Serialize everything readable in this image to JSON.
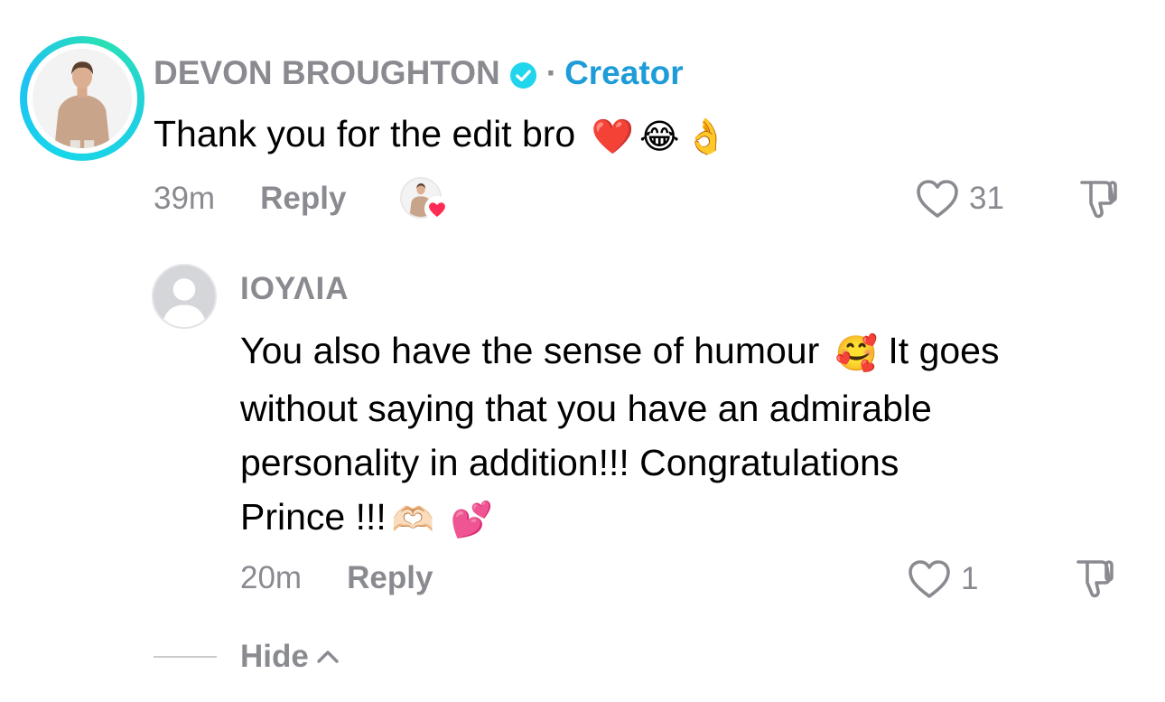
{
  "comment": {
    "username": "DEVON BROUGHTON",
    "separator": "·",
    "role_tag": "Creator",
    "text": "Thank you for the edit bro",
    "emojis": [
      "❤️",
      "😂",
      "👌"
    ],
    "time": "39m",
    "reply_label": "Reply",
    "like_count": "31"
  },
  "reply": {
    "username": "ΙΟΥΛΙΑ",
    "text_lines": [
      "You also have the sense of humour",
      "without saying that you have an admirable",
      "personality in addition!!! Congratulations",
      "Prince !!!"
    ],
    "line1_emoji": "🥰",
    "line1_tail": "It goes",
    "line4_emojis": [
      "🫶🏻",
      "💕"
    ],
    "time": "20m",
    "reply_label": "Reply",
    "like_count": "1"
  },
  "hide_label": "Hide",
  "colors": {
    "muted": "#8a8b91",
    "creator_blue": "#1e9cd7",
    "ring": "#18d6e9",
    "heart": "#fe2c55"
  }
}
